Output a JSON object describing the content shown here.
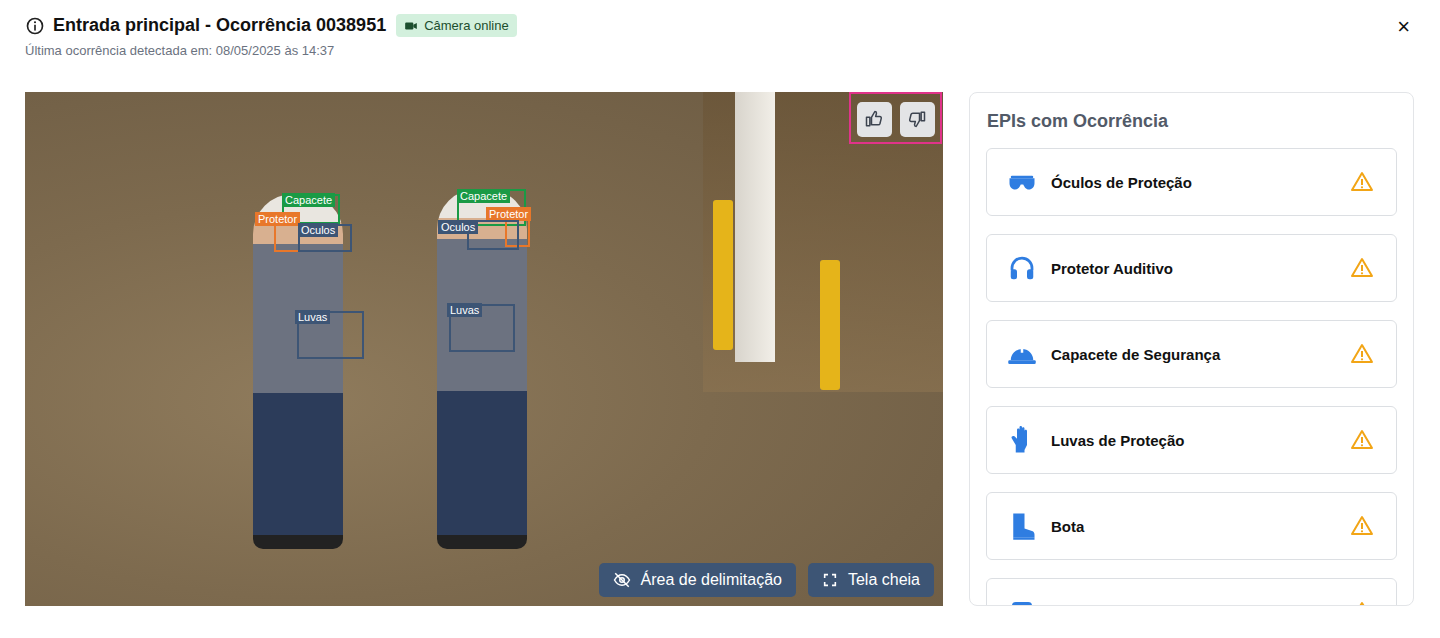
{
  "header": {
    "title": "Entrada principal - Ocorrência 0038951",
    "badge": "Câmera online",
    "subtitle": "Última ocorrência detectada em: 08/05/2025 às 14:37",
    "close": "×"
  },
  "camera": {
    "detections": [
      {
        "label": "Capacete",
        "color": "#1a9a45"
      },
      {
        "label": "Protetor",
        "color": "#e8772a"
      },
      {
        "label": "Oculos",
        "color": "#3d5575"
      },
      {
        "label": "Luvas",
        "color": "#3d5575"
      },
      {
        "label": "Capacete",
        "color": "#1a9a45"
      },
      {
        "label": "Protetor",
        "color": "#e8772a"
      },
      {
        "label": "Oculos",
        "color": "#3d5575"
      },
      {
        "label": "Luvas",
        "color": "#3d5575"
      }
    ],
    "feedback": [
      {
        "vote": "like",
        "selected": false
      },
      {
        "vote": "dislike",
        "selected": false
      }
    ],
    "buttons": [
      "Área de delimitação",
      "Tela cheia"
    ]
  },
  "panel": {
    "title": "EPIs com Ocorrência",
    "items": [
      {
        "label": "Óculos de Proteção"
      },
      {
        "label": "Protetor Auditivo"
      },
      {
        "label": "Capacete de Segurança"
      },
      {
        "label": "Luvas de Proteção"
      },
      {
        "label": "Bota"
      },
      {
        "label": ""
      }
    ]
  }
}
